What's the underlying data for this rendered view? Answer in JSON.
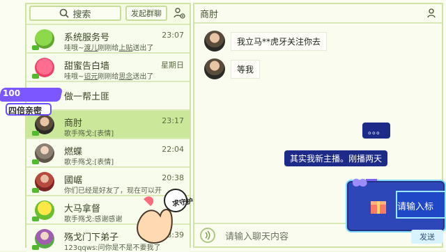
{
  "left": {
    "search_label": "搜索",
    "group_button": "发起群聊",
    "items": [
      {
        "name": "系统服务号",
        "time": "23:07",
        "msg_pre": "哇哦~",
        "msg_user": "渡儿",
        "msg_mid": "刚刚给",
        "msg_target": "上贴",
        "msg_post": "送出了"
      },
      {
        "name": "甜蜜告白墙",
        "time": "星期日",
        "msg_pre": "哇哦~",
        "msg_user": "诏元",
        "msg_mid": "刚刚给",
        "msg_target": "思念",
        "msg_post": "送出了"
      },
      {
        "name": "做一帮土匪",
        "time": "",
        "msg_pre": "",
        "msg_user": "",
        "msg_mid": "",
        "msg_target": "",
        "msg_post": ""
      },
      {
        "name": "商肘",
        "time": "23:17",
        "msg_pre": "歌手殇戈:[表情]",
        "msg_user": "",
        "msg_mid": "",
        "msg_target": "",
        "msg_post": ""
      },
      {
        "name": "燃蝶",
        "time": "22:04",
        "msg_pre": "歌手殇戈:[表情]",
        "msg_user": "",
        "msg_mid": "",
        "msg_target": "",
        "msg_post": ""
      },
      {
        "name": "國崌",
        "time": "20:38",
        "msg_pre": "你们已经是好友了，现在可以开",
        "msg_user": "",
        "msg_mid": "",
        "msg_target": "",
        "msg_post": ""
      },
      {
        "name": "大马拿督",
        "time": "",
        "msg_pre": "歌手殇戈:感谢感谢",
        "msg_user": "",
        "msg_mid": "",
        "msg_target": "",
        "msg_post": ""
      },
      {
        "name": "殇戈门下弟子",
        "time": "8:39",
        "msg_pre": "123qqws:问你是不是不要我了",
        "msg_user": "",
        "msg_mid": "",
        "msg_target": "",
        "msg_post": ""
      }
    ]
  },
  "right": {
    "title": "商肘",
    "messages": [
      {
        "text": "我立马**虎牙关注你去"
      },
      {
        "text": "等我"
      }
    ],
    "input_placeholder": "请输入聊天内容"
  },
  "overlay": {
    "promo_line1": "100",
    "promo_line2": "四倍亲密",
    "barrage_1": "。。。",
    "barrage_2": "其实我新主播。刚播两天",
    "gift_label": "请输入标",
    "send_label": "发送",
    "hand_text": "求守护"
  },
  "colors": {
    "accent": "#cbe89a",
    "barrage": "#1e2a88",
    "gift": "#2d47b8"
  }
}
